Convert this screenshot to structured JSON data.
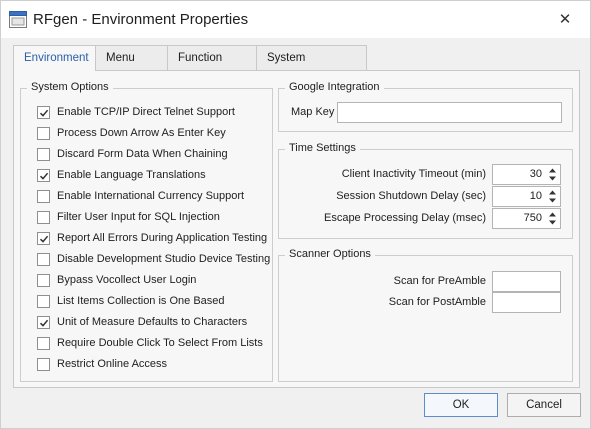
{
  "window": {
    "title": "RFgen - Environment Properties",
    "app_icon": "rfgen-window-icon",
    "close_glyph": "✕"
  },
  "tabs": [
    {
      "label": "Environment",
      "active": true
    },
    {
      "label": "Menu Strip",
      "active": false
    },
    {
      "label": "Function Keys",
      "active": false
    },
    {
      "label": "System Properties",
      "active": false
    }
  ],
  "system_options": {
    "title": "System Options",
    "items": [
      {
        "label": "Enable TCP/IP Direct Telnet Support",
        "checked": true
      },
      {
        "label": "Process Down Arrow As Enter Key",
        "checked": false
      },
      {
        "label": "Discard Form Data When Chaining",
        "checked": false
      },
      {
        "label": "Enable Language Translations",
        "checked": true
      },
      {
        "label": "Enable International Currency Support",
        "checked": false
      },
      {
        "label": "Filter User Input for SQL Injection",
        "checked": false
      },
      {
        "label": "Report All Errors During Application Testing",
        "checked": true
      },
      {
        "label": "Disable Development Studio Device Testing",
        "checked": false
      },
      {
        "label": "Bypass Vocollect User Login",
        "checked": false
      },
      {
        "label": "List Items Collection is One Based",
        "checked": false
      },
      {
        "label": "Unit of Measure Defaults to Characters",
        "checked": true
      },
      {
        "label": "Require Double Click To Select From Lists",
        "checked": false
      },
      {
        "label": "Restrict Online Access",
        "checked": false
      }
    ]
  },
  "google_integration": {
    "title": "Google Integration",
    "map_key_label": "Map Key",
    "map_key_value": ""
  },
  "time_settings": {
    "title": "Time Settings",
    "fields": [
      {
        "label": "Client Inactivity Timeout (min)",
        "value": "30"
      },
      {
        "label": "Session Shutdown Delay (sec)",
        "value": "10"
      },
      {
        "label": "Escape Processing Delay (msec)",
        "value": "750"
      }
    ]
  },
  "scanner_options": {
    "title": "Scanner Options",
    "preamble_label": "Scan for PreAmble",
    "preamble_value": "",
    "postamble_label": "Scan for PostAmble",
    "postamble_value": ""
  },
  "buttons": {
    "ok": "OK",
    "cancel": "Cancel"
  },
  "colors": {
    "accent": "#2a5fa6",
    "check": "#333333"
  }
}
